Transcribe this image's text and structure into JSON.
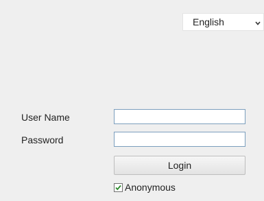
{
  "language": {
    "selected": "English",
    "chevron_icon": "chevron-down-icon"
  },
  "form": {
    "username_label": "User Name",
    "username_value": "",
    "password_label": "Password",
    "password_value": "",
    "login_label": "Login",
    "anonymous_label": "Anonymous",
    "anonymous_checked": true
  },
  "colors": {
    "panel_bg": "#efefef",
    "input_border": "#7b9ebd",
    "check_mark": "#2a8a2a"
  }
}
